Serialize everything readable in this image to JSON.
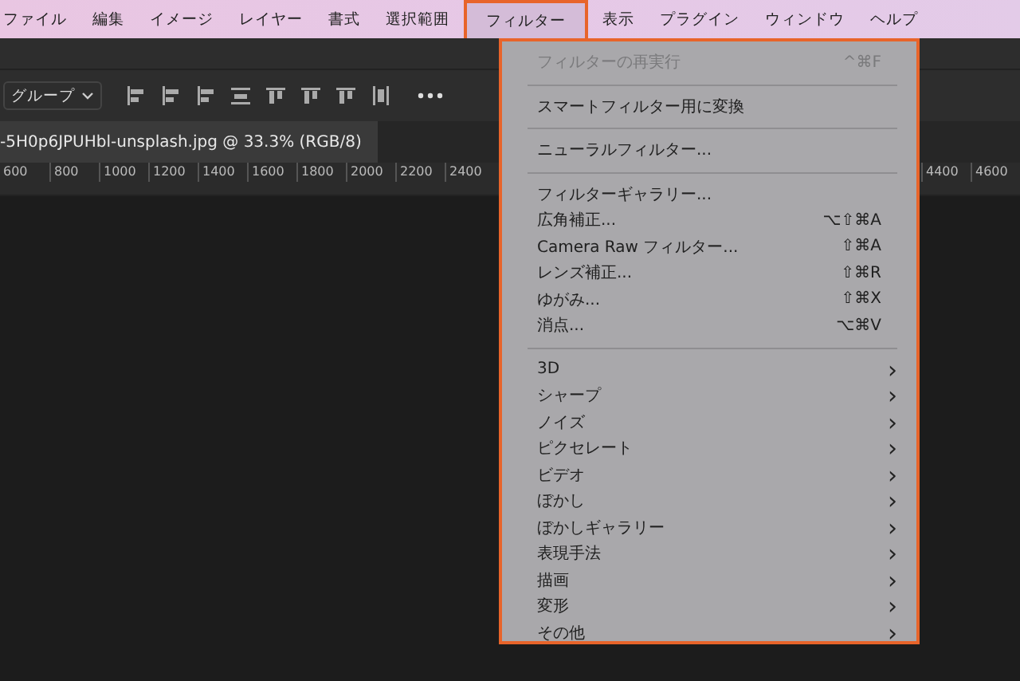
{
  "menubar": [
    {
      "label": "ファイル",
      "selected": false
    },
    {
      "label": "編集",
      "selected": false
    },
    {
      "label": "イメージ",
      "selected": false
    },
    {
      "label": "レイヤー",
      "selected": false
    },
    {
      "label": "書式",
      "selected": false
    },
    {
      "label": "選択範囲",
      "selected": false
    },
    {
      "label": "フィルター",
      "selected": true
    },
    {
      "label": "表示",
      "selected": false
    },
    {
      "label": "プラグイン",
      "selected": false
    },
    {
      "label": "ウィンドウ",
      "selected": false
    },
    {
      "label": "ヘルプ",
      "selected": false
    }
  ],
  "toolbar": {
    "dropdown": "グループ"
  },
  "document_tab": {
    "title": "-5H0p6JPUHbl-unsplash.jpg @ 33.3% (RGB/8)"
  },
  "ruler": {
    "left_labels": [
      "600",
      "800",
      "1000",
      "1200",
      "1400",
      "1600",
      "1800",
      "2000",
      "2200",
      "2400"
    ],
    "right_labels": [
      "4400",
      "4600"
    ]
  },
  "filter_menu": [
    {
      "kind": "command",
      "label": "フィルターの再実行",
      "shortcut": "^⌘F",
      "disabled": true
    },
    {
      "kind": "separator"
    },
    {
      "kind": "command",
      "label": "スマートフィルター用に変換",
      "disabled": false
    },
    {
      "kind": "separator"
    },
    {
      "kind": "command",
      "label": "ニューラルフィルター...",
      "disabled": false
    },
    {
      "kind": "separator"
    },
    {
      "kind": "command",
      "label": "フィルターギャラリー...",
      "disabled": false
    },
    {
      "kind": "command",
      "label": "広角補正...",
      "shortcut": "⌥⇧⌘A",
      "disabled": false
    },
    {
      "kind": "command",
      "label": "Camera Raw フィルター...",
      "shortcut": "⇧⌘A",
      "disabled": false
    },
    {
      "kind": "command",
      "label": "レンズ補正...",
      "shortcut": "⇧⌘R",
      "disabled": false
    },
    {
      "kind": "command",
      "label": "ゆがみ...",
      "shortcut": "⇧⌘X",
      "disabled": false
    },
    {
      "kind": "command",
      "label": "消点...",
      "shortcut": "⌥⌘V",
      "disabled": false
    },
    {
      "kind": "separator"
    },
    {
      "kind": "submenu",
      "label": "3D",
      "arrow": "›"
    },
    {
      "kind": "submenu",
      "label": "シャープ",
      "arrow": "›"
    },
    {
      "kind": "submenu",
      "label": "ノイズ",
      "arrow": "›"
    },
    {
      "kind": "submenu",
      "label": "ピクセレート",
      "arrow": "›"
    },
    {
      "kind": "submenu",
      "label": "ビデオ",
      "arrow": "›"
    },
    {
      "kind": "submenu",
      "label": "ぼかし",
      "arrow": "›"
    },
    {
      "kind": "submenu",
      "label": "ぼかしギャラリー",
      "arrow": "›"
    },
    {
      "kind": "submenu",
      "label": "表現手法",
      "arrow": "›"
    },
    {
      "kind": "submenu",
      "label": "描画",
      "arrow": "›"
    },
    {
      "kind": "submenu",
      "label": "変形",
      "arrow": "›"
    },
    {
      "kind": "submenu",
      "label": "その他",
      "arrow": "›"
    }
  ]
}
